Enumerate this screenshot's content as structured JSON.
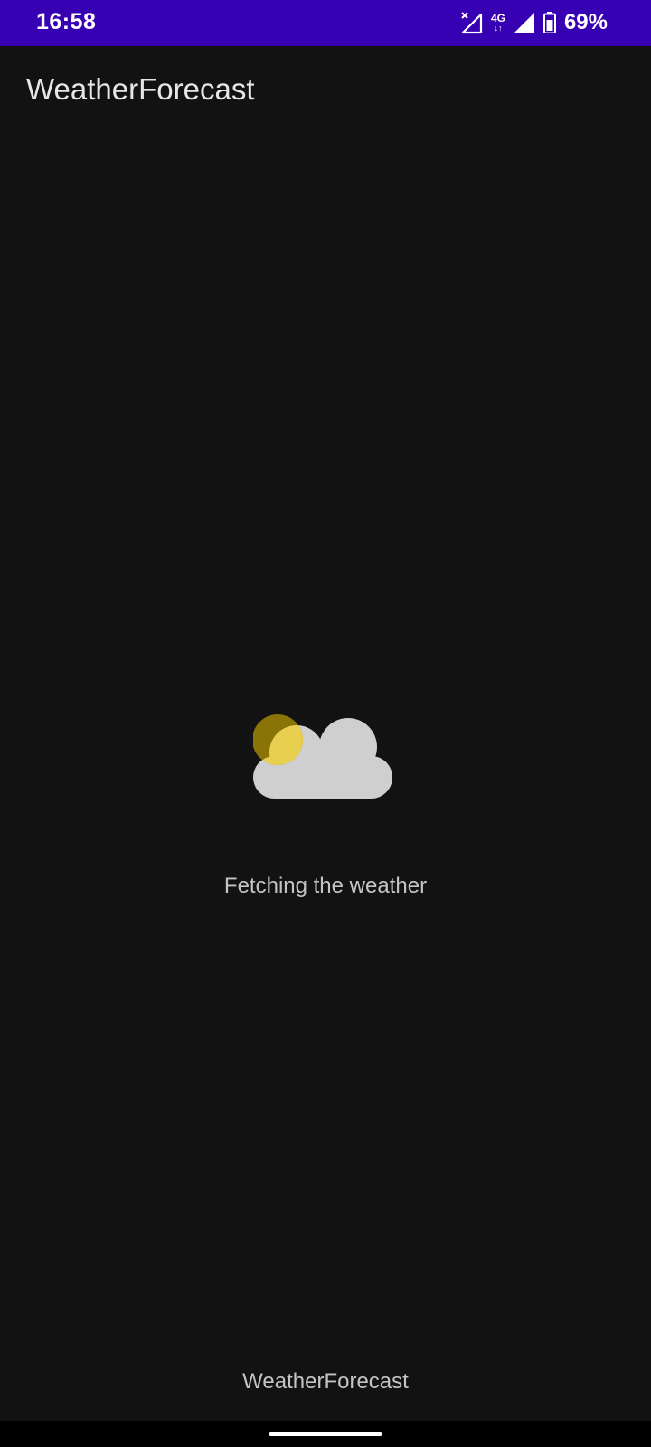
{
  "status_bar": {
    "time": "16:58",
    "network_type": "4G",
    "network_arrows": "↓↑",
    "battery_percent": "69%",
    "background_color": "#3700b3"
  },
  "app_bar": {
    "title": "WeatherForecast"
  },
  "main": {
    "icon": "partly-cloudy-icon",
    "loading_text": "Fetching the weather",
    "sun_color": "#e8cf50",
    "cloud_color": "#cfcfcf"
  },
  "footer": {
    "title": "WeatherForecast"
  },
  "colors": {
    "background": "#121212"
  }
}
